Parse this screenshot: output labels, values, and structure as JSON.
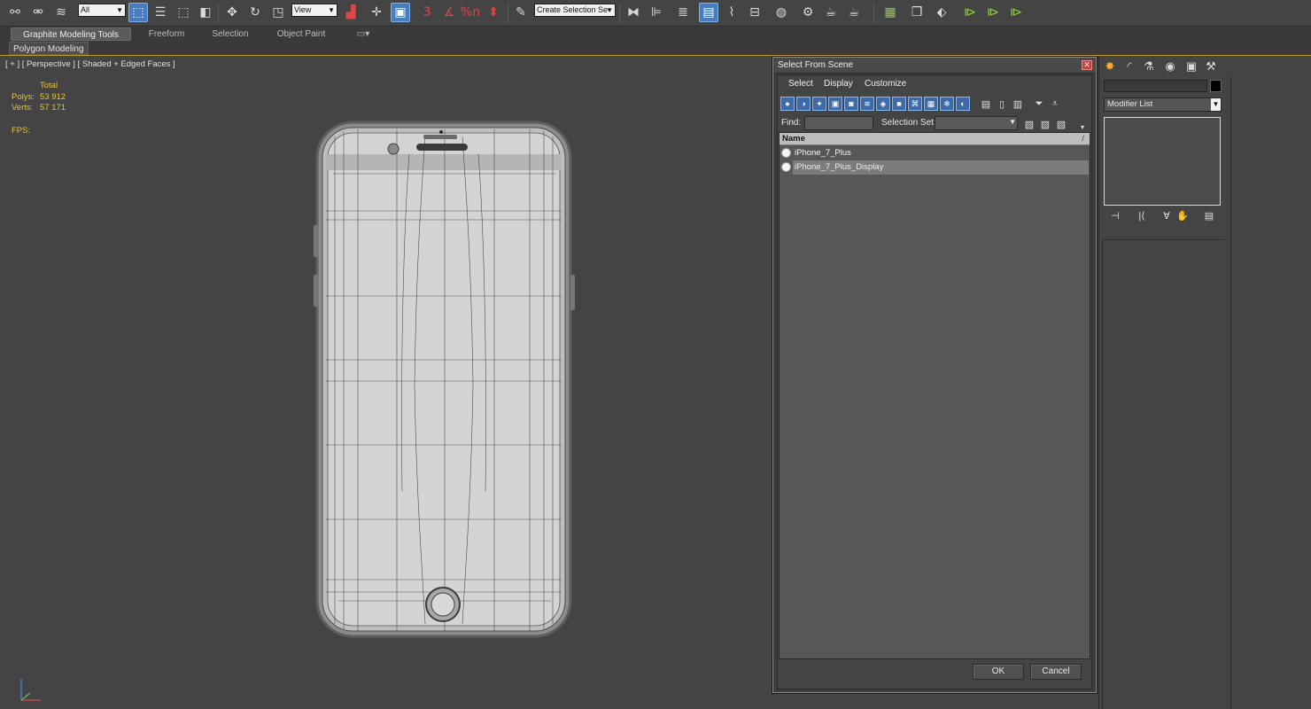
{
  "toolbar": {
    "selection_filter": "All",
    "reference_coord": "View",
    "named_selection_placeholder": "Create Selection Se",
    "snap_label": "3",
    "percent_snap_label": "%n",
    "icons": [
      "link-icon",
      "unlink-icon",
      "bind-spacewarp-icon",
      "select-object-icon",
      "select-by-name-icon",
      "rectangular-region-icon",
      "window-crossing-icon",
      "move-icon",
      "rotate-icon",
      "scale-icon",
      "select-manipulate-icon",
      "pivot-center-icon",
      "keyboard-shortcut-icon",
      "snap-toggle-icon",
      "angle-snap-icon",
      "percent-snap-icon",
      "spinner-snap-icon",
      "edit-named-selection-icon",
      "mirror-icon",
      "align-icon",
      "layer-manager-icon",
      "scene-explorer-icon",
      "curve-editor-icon",
      "schematic-view-icon",
      "material-editor-icon",
      "render-setup-icon",
      "rendered-frame-icon",
      "render-icon",
      "bake-icon",
      "container-icon",
      "render-to-texture-icon",
      "play-icon",
      "key-mode-icon",
      "auto-key-icon"
    ]
  },
  "ribbon": {
    "tabs": [
      "Graphite Modeling Tools",
      "Freeform",
      "Selection",
      "Object Paint"
    ],
    "active_tab": "Graphite Modeling Tools",
    "panel_label": "Polygon Modeling"
  },
  "viewport": {
    "label": "[ + ] [ Perspective ] [ Shaded + Edged Faces ]",
    "stats": {
      "total_label": "Total",
      "polys_label": "Polys:",
      "polys_value": "53 912",
      "verts_label": "Verts:",
      "verts_value": "57 171",
      "fps_label": "FPS:"
    }
  },
  "dialog": {
    "title": "Select From Scene",
    "menu": [
      "Select",
      "Display",
      "Customize"
    ],
    "find_label": "Find:",
    "selection_set_label": "Selection Set:",
    "list_header": "Name",
    "sort_indicator": "/",
    "items": [
      {
        "name": "iPhone_7_Plus",
        "selected": false
      },
      {
        "name": "iPhone_7_Plus_Display",
        "selected": true
      }
    ],
    "ok_label": "OK",
    "cancel_label": "Cancel"
  },
  "command_panel": {
    "tabs": [
      "create-icon",
      "modify-icon",
      "hierarchy-icon",
      "motion-icon",
      "display-icon",
      "utilities-icon"
    ],
    "active_tab": "create-icon",
    "modifier_list_label": "Modifier List",
    "object_color": "#000000"
  },
  "colors": {
    "background": "#444444",
    "accent_blue": "#4a7dbd",
    "stats_yellow": "#e8c33a",
    "ribbon_border": "#c49a1f"
  }
}
